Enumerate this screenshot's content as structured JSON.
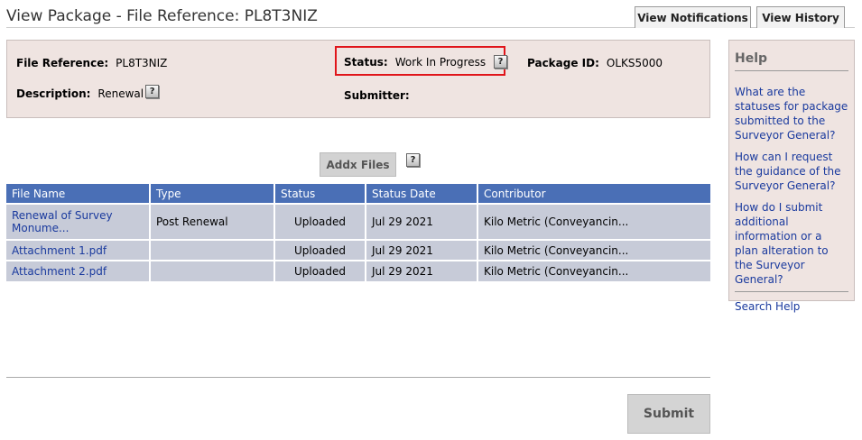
{
  "page": {
    "title": "View Package - File Reference: PL8T3NIZ"
  },
  "tabs": {
    "notifications": "View Notifications",
    "history": "View History"
  },
  "package": {
    "file_reference_label": "File Reference:",
    "file_reference_value": "PL8T3NIZ",
    "status_label": "Status:",
    "status_value": "Work In Progress",
    "package_id_label": "Package ID:",
    "package_id_value": "OLKS5000",
    "description_label": "Description:",
    "description_value": "Renewal",
    "submitter_label": "Submitter:",
    "submitter_value": ""
  },
  "help_icon_glyph": "?",
  "actions": {
    "addx_files": "Addx Files",
    "submit": "Submit"
  },
  "files_table": {
    "columns": [
      "File Name",
      "Type",
      "Status",
      "Status Date",
      "Contributor"
    ],
    "rows": [
      {
        "name": "Renewal of Survey Monume...",
        "type": "Post Renewal",
        "status": "Uploaded",
        "date": "Jul 29 2021",
        "contributor": "Kilo Metric (Conveyancin..."
      },
      {
        "name": "Attachment 1.pdf",
        "type": "",
        "status": "Uploaded",
        "date": "Jul 29 2021",
        "contributor": "Kilo Metric (Conveyancin..."
      },
      {
        "name": "Attachment 2.pdf",
        "type": "",
        "status": "Uploaded",
        "date": "Jul 29 2021",
        "contributor": "Kilo Metric (Conveyancin..."
      }
    ]
  },
  "help": {
    "title": "Help",
    "links": [
      "What are the statuses for package submitted to the Surveyor General?",
      "How can I request the guidance of the Surveyor General?",
      "How do I submit additional information or a plan alteration to the Surveyor General?"
    ],
    "search": "Search Help"
  },
  "colors": {
    "header_blue": "#4a6fb6",
    "panel_bg": "#efe4e1",
    "highlight_red": "#e0151b",
    "link_blue": "#1a3a9e"
  }
}
